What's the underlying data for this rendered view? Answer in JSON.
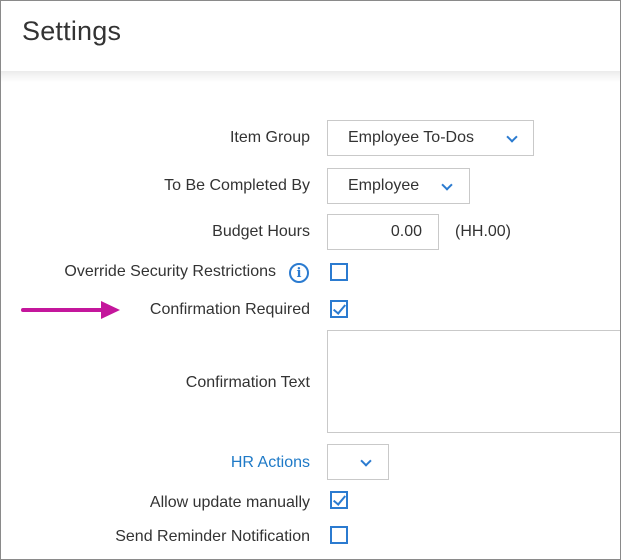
{
  "page": {
    "title": "Settings"
  },
  "fields": {
    "item_group": {
      "label": "Item Group",
      "value": "Employee To-Dos"
    },
    "completed_by": {
      "label": "To Be Completed By",
      "value": "Employee"
    },
    "budget_hours": {
      "label": "Budget Hours",
      "value": "0.00",
      "hint": "(HH.00)"
    },
    "override_security": {
      "label": "Override Security Restrictions",
      "checked": false
    },
    "confirmation_required": {
      "label": "Confirmation Required",
      "checked": true
    },
    "confirmation_text": {
      "label": "Confirmation Text",
      "value": ""
    },
    "hr_actions": {
      "label": "HR Actions",
      "value": ""
    },
    "allow_update": {
      "label": "Allow update manually",
      "checked": true
    },
    "send_reminder": {
      "label": "Send Reminder Notification",
      "checked": false
    }
  },
  "icons": {
    "info": "i"
  },
  "colors": {
    "accent": "#2b7bd0",
    "link": "#1f7ac7",
    "arrow": "#c4169c"
  }
}
